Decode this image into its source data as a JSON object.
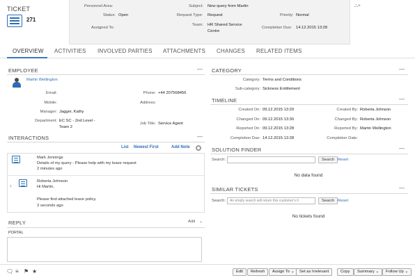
{
  "header": {
    "ticket_label": "TICKET",
    "ticket_number": "271",
    "personnel_area_label": "Personnel Area:",
    "personnel_area_value": "",
    "status_label": "Status:",
    "status_value": "Open",
    "assigned_to_label": "Assigned To:",
    "assigned_to_value": "",
    "subject_label": "Subject:",
    "subject_value": "New query from Martin",
    "request_type_label": "Request Type:",
    "request_type_value": "Request",
    "team_label": "Team:",
    "team_value_line1": "HR Shared Service",
    "team_value_line2": "Centre",
    "priority_label": "Priority:",
    "priority_value": "Normal",
    "completion_due_label": "Completion Due:",
    "completion_due_value": "14.12.2015 13:28",
    "tag_icon_text": "⛬+"
  },
  "tabs": [
    "OVERVIEW",
    "ACTIVITIES",
    "INVOLVED PARTIES",
    "ATTACHMENTS",
    "CHANGES",
    "RELATED ITEMS"
  ],
  "employee": {
    "title": "EMPLOYEE",
    "name": "Martin Wellington",
    "email_label": "Email:",
    "email_value": "",
    "phone_label": "Phone:",
    "phone_value": "+44 207568456",
    "mobile_label": "Mobile:",
    "mobile_value": "",
    "address_label": "Address:",
    "address_value": "",
    "manager_label": "Manager:",
    "manager_value": "Jagger, Kathy",
    "department_label": "Department:",
    "department_value_line1": "EC SC - 2nd Level -",
    "department_value_line2": "Team 2",
    "job_title_label": "Job Title:",
    "job_title_value": "Service Agent"
  },
  "interactions": {
    "title": "INTERACTIONS",
    "list_label": "List",
    "newest_first_label": "Newest First",
    "add_note_label": "Add Note",
    "items": [
      {
        "author": "Mark Jennings",
        "text": "Details of my query - Please help with my leave request",
        "time": "2 minutes ago"
      },
      {
        "author": "Roberta Johnson",
        "line1": "Hi Martin,",
        "line2": "Please find attached leave policy.",
        "time": "3 seconds ago"
      }
    ]
  },
  "reply": {
    "title": "REPLY",
    "add_label": "Add",
    "portal_label": "PORTAL"
  },
  "category": {
    "title": "CATEGORY",
    "category_label": "Category:",
    "category_value": "Terms and Conditions",
    "subcategory_label": "Sub-category:",
    "subcategory_value": "Sickness Entitlement"
  },
  "timeline": {
    "title": "TIMELINE",
    "created_on_label": "Created On:",
    "created_on_value": "09.12.2015 13:29",
    "created_by_label": "Created By:",
    "created_by_value": "Roberta Johnson",
    "changed_on_label": "Changed On:",
    "changed_on_value": "09.12.2015 13:30",
    "changed_by_label": "Changed By:",
    "changed_by_value": "Roberta Johnson",
    "reported_on_label": "Reported On:",
    "reported_on_value": "09.12.2015 13:28",
    "reported_by_label": "Reported By:",
    "reported_by_value": "Martin Wellington",
    "completion_due_label": "Completion Due:",
    "completion_due_value": "14.12.2015 13:28",
    "completion_date_label": "Completion Date:",
    "completion_date_value": ""
  },
  "solution_finder": {
    "title": "SOLUTION FINDER",
    "search_label": "Search:",
    "search_placeholder": "",
    "search_button": "Search",
    "reset_link": "Reset",
    "empty_text": "No data found"
  },
  "similar_tickets": {
    "title": "SIMILAR TICKETS",
    "search_label": "Search:",
    "search_placeholder": "An empty search will return this customer's ti",
    "search_button": "Search",
    "reset_link": "Reset",
    "empty_text": "No tickets found"
  },
  "toolbar": {
    "left_icons": [
      "🗨",
      "≡",
      "⚑",
      "★"
    ],
    "edit": "Edit",
    "refresh": "Refresh",
    "assign_to": "Assign To ⌄",
    "set_irrelevant": "Set as Irrelevant",
    "copy": "Copy",
    "summary": "Summary ⌄",
    "follow_up": "Follow Up ⌄"
  },
  "colors": {
    "accent": "#2f6eb5",
    "tab_underline": "#3b78c2",
    "header_bg": "#f2f2f2"
  }
}
